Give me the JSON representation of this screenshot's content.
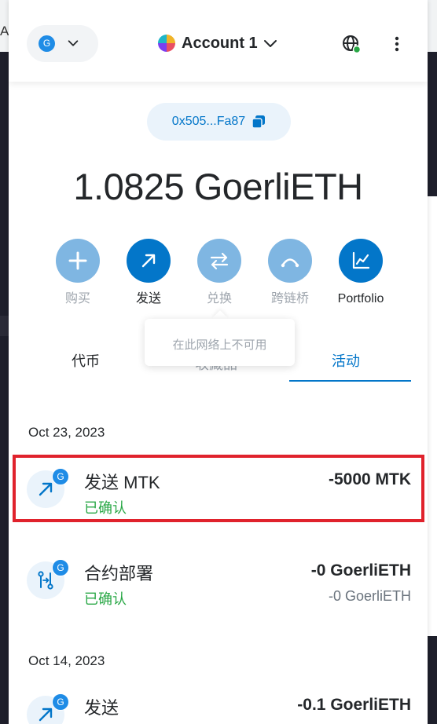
{
  "browser": {
    "edge_letter": "A"
  },
  "network": {
    "badge": "G"
  },
  "account": {
    "name": "Account 1"
  },
  "address": {
    "short": "0x505...Fa87"
  },
  "balance": {
    "text": "1.0825 GoerliETH"
  },
  "actions": [
    {
      "label": "购买",
      "icon": "plus-icon",
      "state": "disabled"
    },
    {
      "label": "发送",
      "icon": "send-arrow-icon",
      "state": "active"
    },
    {
      "label": "兑换",
      "icon": "swap-icon",
      "state": "disabled"
    },
    {
      "label": "跨链桥",
      "icon": "bridge-icon",
      "state": "disabled"
    },
    {
      "label": "Portfolio",
      "icon": "chart-icon",
      "state": "active"
    }
  ],
  "tooltip": {
    "text": "在此网络上不可用"
  },
  "tabs": {
    "tokens": "代币",
    "nft": "收藏品",
    "activity": "活动"
  },
  "activity": {
    "groups": [
      {
        "date": "Oct 23, 2023",
        "items": [
          {
            "title": "发送 MTK",
            "status": "已确认",
            "amount": "-5000 MTK",
            "sub": "",
            "icon": "send-arrow-icon",
            "badge": "G"
          },
          {
            "title": "合约部署",
            "status": "已确认",
            "amount": "-0 GoerliETH",
            "sub": "-0 GoerliETH",
            "icon": "contract-deploy-icon",
            "badge": "G"
          }
        ]
      },
      {
        "date": "Oct 14, 2023",
        "items": [
          {
            "title": "发送",
            "status": "",
            "amount": "-0.1 GoerliETH",
            "sub": "",
            "icon": "send-arrow-icon",
            "badge": "G"
          }
        ]
      }
    ]
  },
  "colors": {
    "accent": "#0376c9",
    "accent_disabled": "#7fb6e2",
    "confirmed": "#28a745",
    "highlight": "#e0222c",
    "network_badge": "#1f8ce6"
  }
}
